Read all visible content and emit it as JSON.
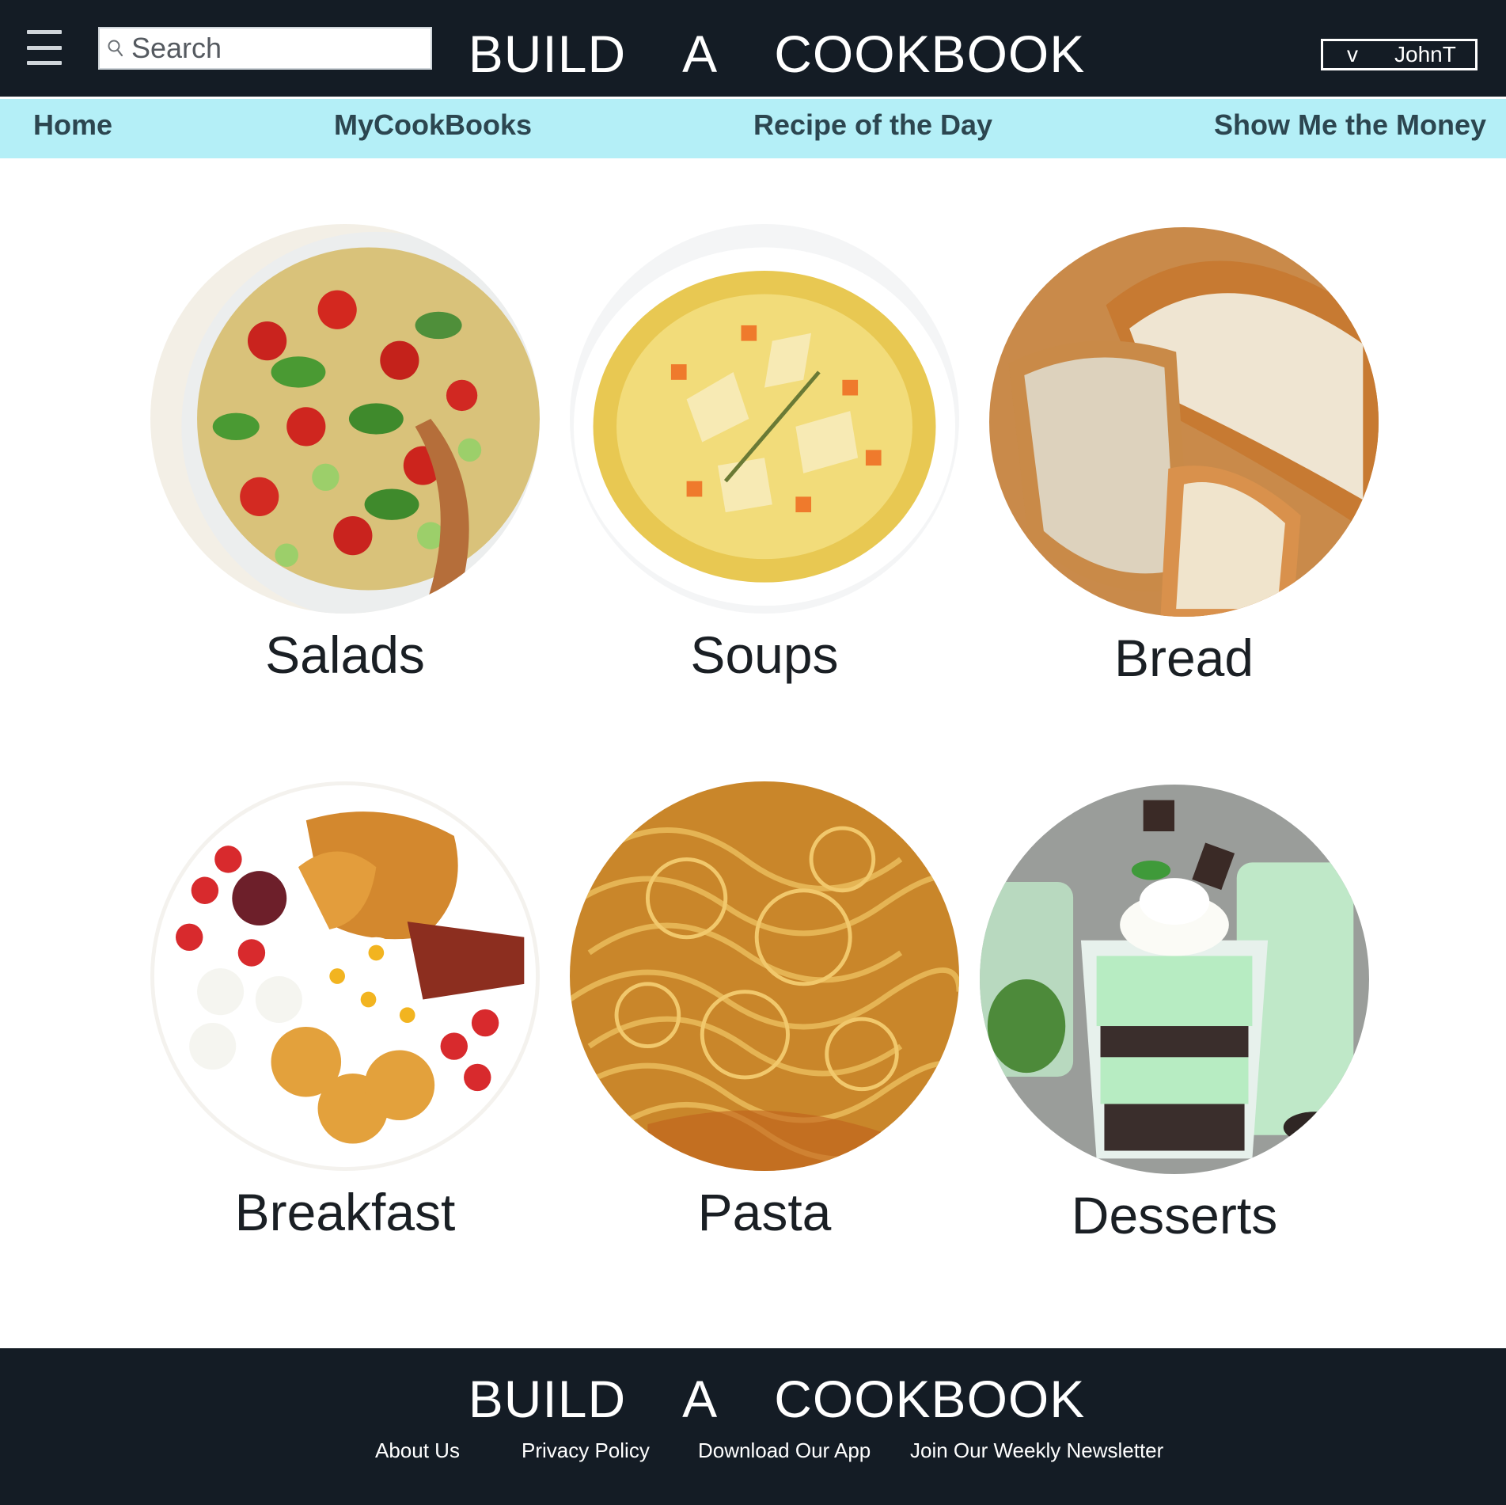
{
  "header": {
    "menu_icon": "hamburger-icon",
    "search": {
      "placeholder": "Search",
      "icon": "search-icon"
    },
    "title": "BUILD  A  COOKBOOK",
    "user": {
      "caret": "v",
      "name": "JohnT"
    }
  },
  "nav": {
    "items": [
      {
        "label": "Home"
      },
      {
        "label": "MyCookBooks"
      },
      {
        "label": "Recipe of the Day"
      },
      {
        "label": "Show Me the Money"
      }
    ]
  },
  "categories": [
    {
      "label": "Salads",
      "image": "salad-photo"
    },
    {
      "label": "Soups",
      "image": "soup-photo"
    },
    {
      "label": "Bread",
      "image": "bread-photo"
    },
    {
      "label": "Breakfast",
      "image": "breakfast-photo"
    },
    {
      "label": "Pasta",
      "image": "pasta-photo"
    },
    {
      "label": "Desserts",
      "image": "dessert-photo"
    }
  ],
  "footer": {
    "title": "BUILD  A  COOKBOOK",
    "links": [
      {
        "label": "About Us"
      },
      {
        "label": "Privacy Policy"
      },
      {
        "label": "Download Our App"
      },
      {
        "label": "Join Our Weekly Newsletter"
      }
    ]
  },
  "colors": {
    "header_bg": "#141c25",
    "nav_bg": "#b4eff7",
    "nav_text": "#2c4650",
    "label_text": "#1a1f24"
  }
}
